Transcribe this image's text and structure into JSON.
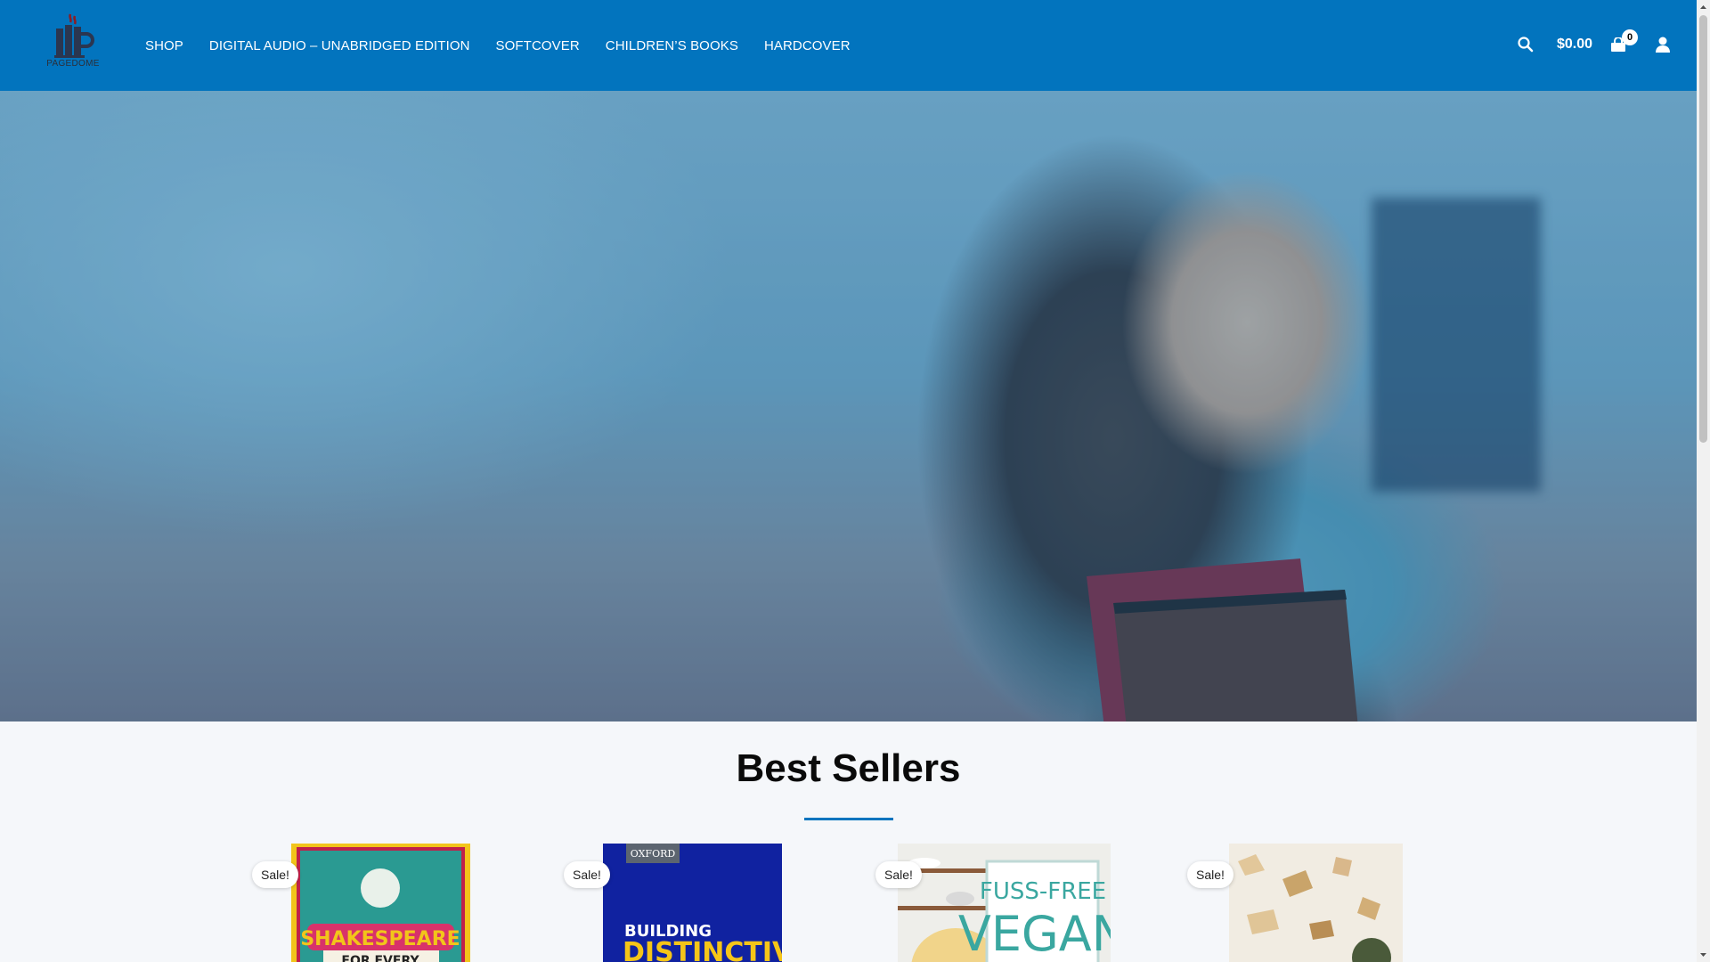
{
  "header": {
    "logo_text": "PAGEDOME",
    "nav": [
      {
        "label": "SHOP"
      },
      {
        "label": "DIGITAL AUDIO – UNABRIDGED EDITION"
      },
      {
        "label": "SOFTCOVER"
      },
      {
        "label": "CHILDREN’S BOOKS"
      },
      {
        "label": "HARDCOVER"
      }
    ],
    "cart_total": "$0.00",
    "cart_count": "0"
  },
  "colors": {
    "brand_blue": "#0274be",
    "page_bg": "#f5f7fa"
  },
  "icons": {
    "logo": "mug-logo-icon",
    "search": "search-icon",
    "cart": "shopping-bag-icon",
    "account": "user-icon"
  },
  "bestsellers": {
    "title": "Best Sellers",
    "products": [
      {
        "badge": "Sale!",
        "cover_text_1": "SHAKESPEARE",
        "cover_text_2": "FOR EVERY"
      },
      {
        "badge": "Sale!",
        "cover_text_1": "OXFORD",
        "cover_text_2": "BUILDING",
        "cover_text_3": "DISTINCTIVE"
      },
      {
        "badge": "Sale!",
        "cover_text_1": "FUSS-FREE",
        "cover_text_2": "VEGAN"
      },
      {
        "badge": "Sale!"
      }
    ]
  }
}
